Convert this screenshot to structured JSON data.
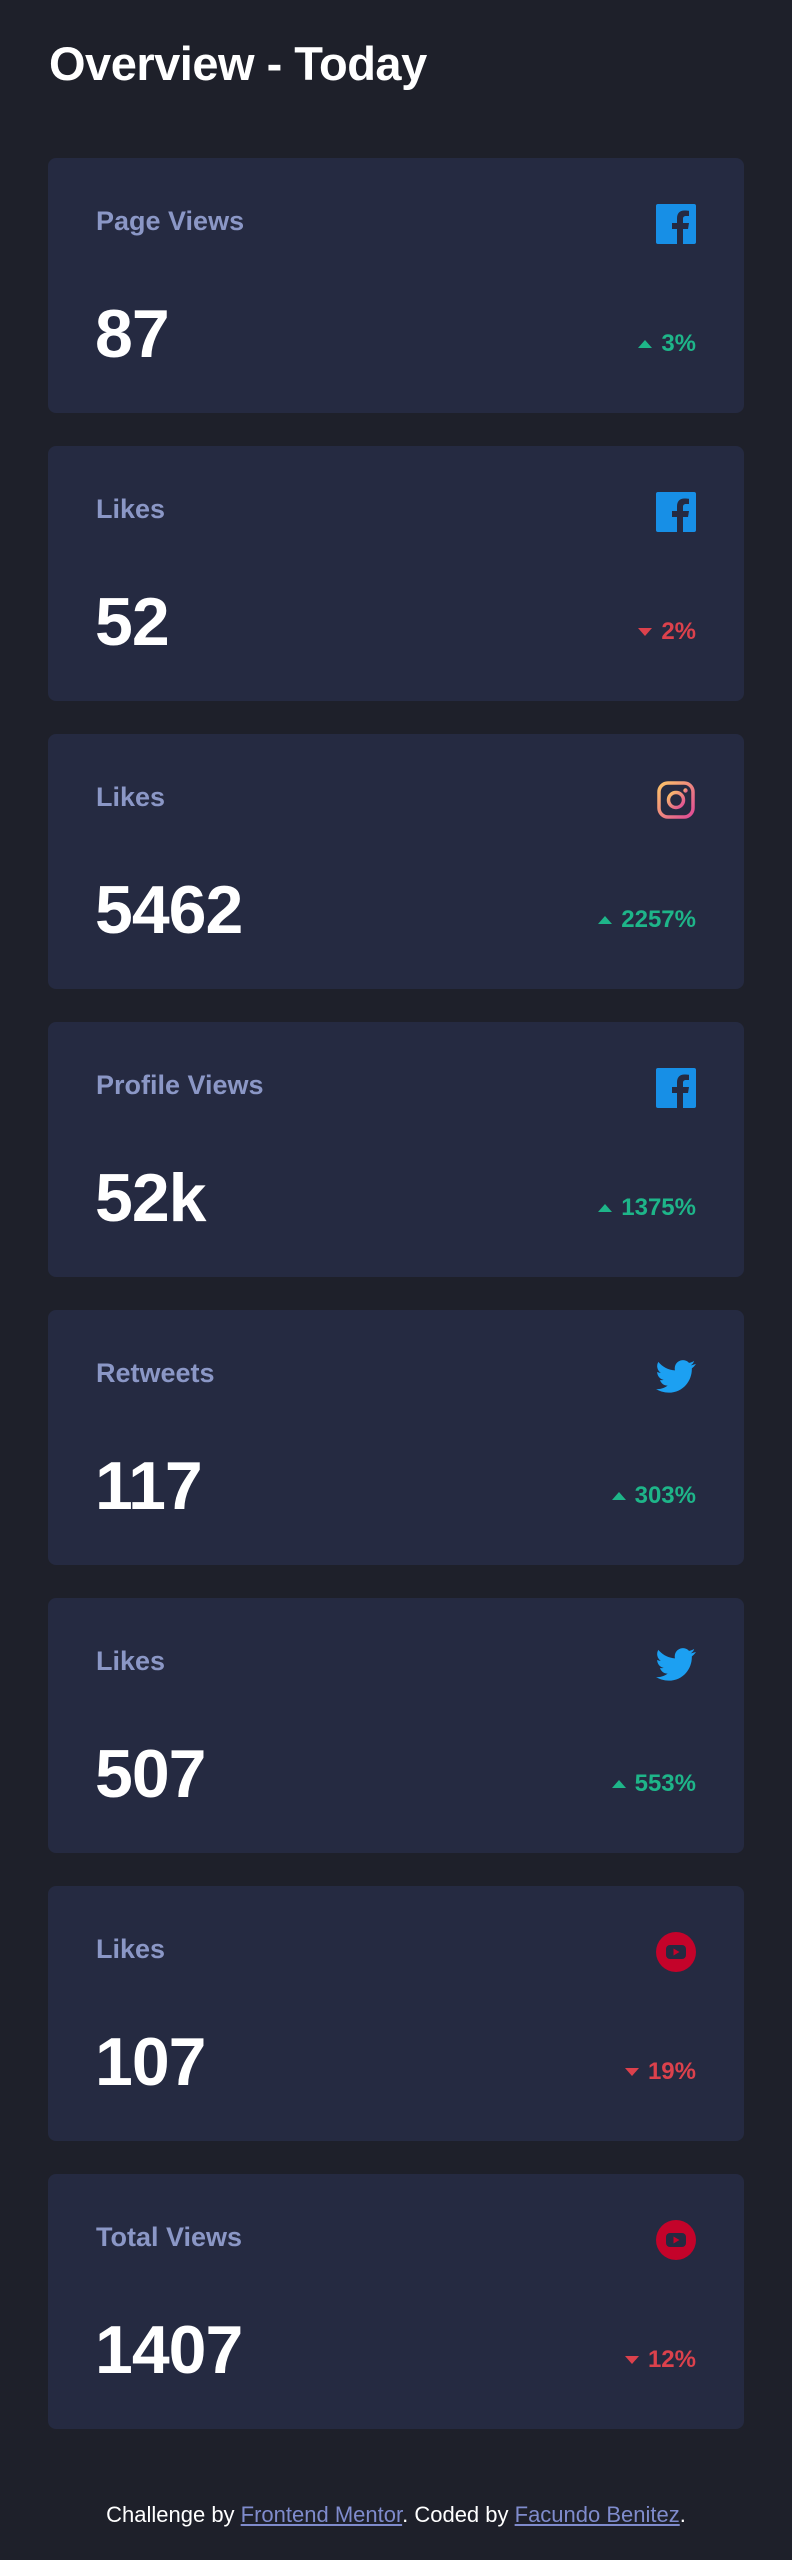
{
  "header": {
    "title": "Overview - Today"
  },
  "colors": {
    "background": "#1e202a",
    "card": "#252a41",
    "label": "#8b97c6",
    "up": "#1eb589",
    "down": "#dc414c",
    "facebook": "#178fe6",
    "twitter": "#1ca0f2",
    "youtube": "#c4032a"
  },
  "cards": [
    {
      "label": "Page Views",
      "icon": "facebook-icon",
      "value": "87",
      "change": "3%",
      "direction": "up"
    },
    {
      "label": "Likes",
      "icon": "facebook-icon",
      "value": "52",
      "change": "2%",
      "direction": "down"
    },
    {
      "label": "Likes",
      "icon": "instagram-icon",
      "value": "5462",
      "change": "2257%",
      "direction": "up"
    },
    {
      "label": "Profile Views",
      "icon": "facebook-icon",
      "value": "52k",
      "change": "1375%",
      "direction": "up"
    },
    {
      "label": "Retweets",
      "icon": "twitter-icon",
      "value": "117",
      "change": "303%",
      "direction": "up"
    },
    {
      "label": "Likes",
      "icon": "twitter-icon",
      "value": "507",
      "change": "553%",
      "direction": "up"
    },
    {
      "label": "Likes",
      "icon": "youtube-icon",
      "value": "107",
      "change": "19%",
      "direction": "down"
    },
    {
      "label": "Total Views",
      "icon": "youtube-icon",
      "value": "1407",
      "change": "12%",
      "direction": "down"
    }
  ],
  "footer": {
    "prefix": "Challenge by ",
    "link1": "Frontend Mentor",
    "middle": ". Coded by ",
    "link2": "Facundo Benitez",
    "suffix": "."
  }
}
